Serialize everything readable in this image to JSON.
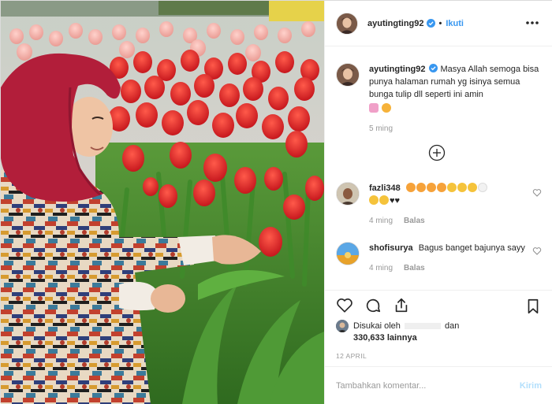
{
  "post": {
    "username": "ayutingting92",
    "follow_label": "Ikuti",
    "dot": "•",
    "photo_description": "Woman in red hijab and patterned dress kneeling among red tulips"
  },
  "caption": {
    "username": "ayutingting92",
    "text": "Masya Allah semoga bisa punya halaman rumah yg isinya semua bunga tulip dll seperti ini amin",
    "time": "5 ming"
  },
  "comments": [
    {
      "username": "fazli348",
      "time": "4 ming",
      "reply_label": "Balas"
    },
    {
      "username": "shofisurya",
      "text": "Bagus banget bajunya sayy",
      "time": "4 ming",
      "reply_label": "Balas"
    }
  ],
  "likes": {
    "prefix": "Disukai oleh",
    "suffix": "dan",
    "count": "330,633 lainnya"
  },
  "date": "12 APRIL",
  "add_comment": {
    "placeholder": "Tambahkan komentar...",
    "post_label": "Kirim"
  },
  "colors": {
    "link_blue": "#3897f0",
    "post_disabled": "#b2dffc",
    "muted": "#999999",
    "verified": "#3897f0"
  },
  "icons": [
    "more-options-icon",
    "verified-badge-icon",
    "load-more-icon",
    "heart-icon",
    "comment-icon",
    "share-icon",
    "bookmark-icon"
  ]
}
